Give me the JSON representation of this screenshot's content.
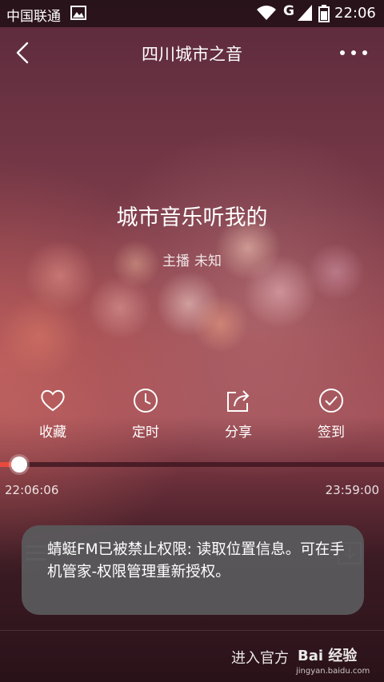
{
  "status_bar": {
    "carrier": "中国联通",
    "time": "22:06",
    "network_type": "G"
  },
  "header": {
    "title": "四川城市之音"
  },
  "now_playing": {
    "song_title": "城市音乐听我的",
    "host_label": "主播",
    "host_name": "未知"
  },
  "actions": [
    {
      "label": "收藏",
      "icon": "heart-icon"
    },
    {
      "label": "定时",
      "icon": "clock-icon"
    },
    {
      "label": "分享",
      "icon": "share-icon"
    },
    {
      "label": "签到",
      "icon": "check-circle-icon"
    }
  ],
  "progress": {
    "current_time": "22:06:06",
    "end_time": "23:59:00",
    "fraction": 0.05
  },
  "toast": {
    "message": "蜻蜓FM已被禁止权限: 读取位置信息。可在手机管家-权限管理重新授权。"
  },
  "footer": {
    "link_text": "进入官方"
  },
  "watermark": {
    "logo_text": "Bai 经验",
    "url": "jingyan.baidu.com"
  },
  "colors": {
    "accent": "#e84a3c",
    "toast_bg": "#5a5a5c"
  }
}
